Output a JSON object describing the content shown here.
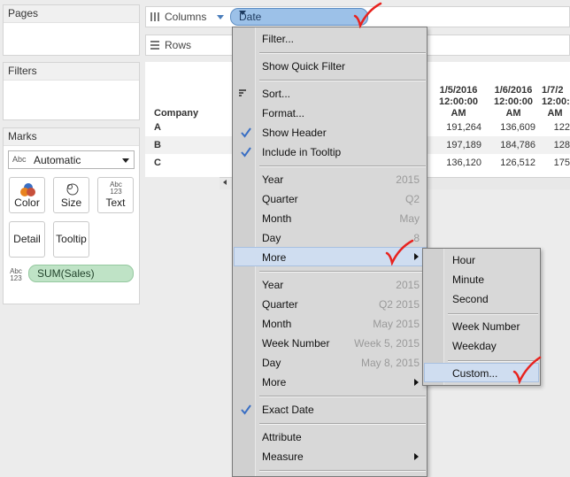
{
  "panels": {
    "pages_title": "Pages",
    "filters_title": "Filters",
    "marks_title": "Marks",
    "marks_type": "Automatic",
    "marks_type_icon": "Abc",
    "mark_buttons": [
      "Color",
      "Size",
      "Text",
      "Detail",
      "Tooltip"
    ],
    "text_icon": "Abc 123",
    "sum_pill": "SUM(Sales)",
    "sum_icon": "Abc 123"
  },
  "shelves": {
    "columns_label": "Columns",
    "rows_label": "Rows",
    "date_pill": "Date"
  },
  "view": {
    "row_header": "Company",
    "rows": [
      "A",
      "B",
      "C"
    ],
    "col_headers": [
      [
        "1/5/2016",
        "12:00:00",
        "AM"
      ],
      [
        "1/6/2016",
        "12:00:00",
        "AM"
      ],
      [
        "1/7/2",
        "12:00:0",
        "AM"
      ]
    ],
    "cells": [
      [
        "191,264",
        "136,609",
        "122"
      ],
      [
        "197,189",
        "184,786",
        "128"
      ],
      [
        "136,120",
        "126,512",
        "175"
      ]
    ]
  },
  "menu": {
    "filter": "Filter...",
    "show_quick_filter": "Show Quick Filter",
    "sort": "Sort...",
    "format": "Format...",
    "show_header": "Show Header",
    "include_tooltip": "Include in Tooltip",
    "parts": [
      {
        "label": "Year",
        "value": "2015"
      },
      {
        "label": "Quarter",
        "value": "Q2"
      },
      {
        "label": "Month",
        "value": "May"
      },
      {
        "label": "Day",
        "value": "8"
      }
    ],
    "more": "More",
    "values": [
      {
        "label": "Year",
        "value": "2015"
      },
      {
        "label": "Quarter",
        "value": "Q2 2015"
      },
      {
        "label": "Month",
        "value": "May 2015"
      },
      {
        "label": "Week Number",
        "value": "Week 5, 2015"
      },
      {
        "label": "Day",
        "value": "May 8, 2015"
      }
    ],
    "more2": "More",
    "exact_date": "Exact Date",
    "attribute": "Attribute",
    "measure": "Measure"
  },
  "submenu": {
    "items": [
      "Hour",
      "Minute",
      "Second",
      "Week Number",
      "Weekday",
      "Custom..."
    ]
  },
  "colors": {
    "date_pill": "#9cc1e8",
    "sum_pill": "#bfe3c6",
    "check": "#3a6fc4",
    "annotation": "#e8231f",
    "highlight": "#cfddf0"
  }
}
